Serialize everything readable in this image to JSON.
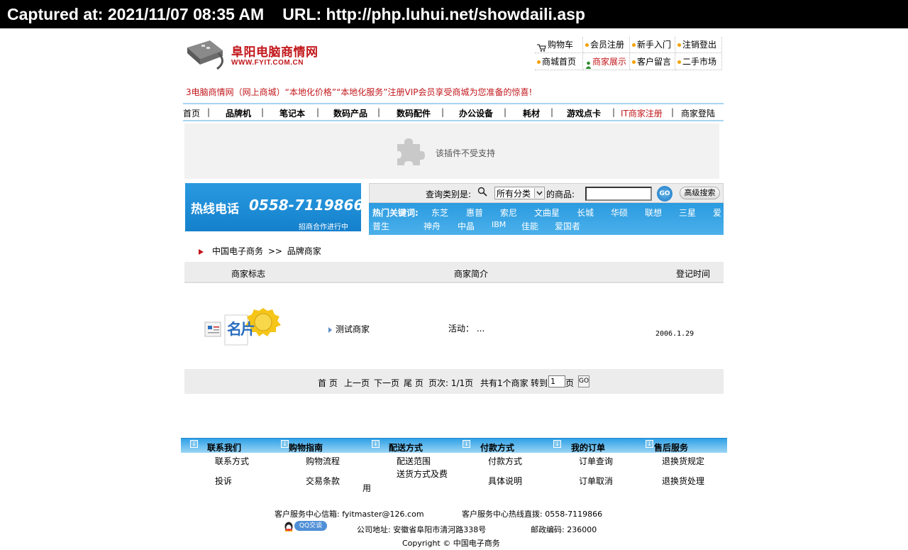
{
  "capture": {
    "captured_at": "Captured at: 2021/11/07 08:35 AM",
    "url": "URL: http://php.luhui.net/showdaili.asp"
  },
  "logo": {
    "name": "阜阳电脑商情网",
    "url": "WWW.FYIT.COM.CN"
  },
  "top_links": {
    "cart": "购物车",
    "register": "会员注册",
    "newbie": "新手入门",
    "logout": "注销登出",
    "home": "商城首页",
    "merchants": "商家展示",
    "message": "客户留言",
    "secondhand": "二手市场"
  },
  "announcement": "3电脑商情网（网上商城）“本地化价格”“本地化服务”注册VIP会员享受商城为您准备的惊喜!",
  "nav": {
    "home": "首页",
    "brand_phone": "品牌机",
    "laptop": "笔记本",
    "digital": "数码产品",
    "accessories": "数码配件",
    "office": "办公设备",
    "consumables": "耗材",
    "game_cards": "游戏点卡",
    "it_register": "IT商家注册",
    "merchant_login": "商家登陆"
  },
  "plugin": {
    "message": "该插件不受支持"
  },
  "hotline": {
    "label": "热线电话",
    "number": "0558-7119866",
    "subtitle": "招商合作进行中"
  },
  "search": {
    "category_label": "查询类别是:",
    "category_value": "所有分类",
    "goods_label": "的商品:",
    "go": "GO",
    "advanced": "高级搜索",
    "hot_label": "热门关键词:",
    "hot_row1": [
      "东芝",
      "惠普",
      "索尼",
      "文曲星",
      "长城",
      "华硕",
      "联想",
      "三星",
      "爱"
    ],
    "hot_row2": [
      "普生",
      "神舟",
      "中晶",
      "IBM",
      "佳能",
      "爱国者"
    ]
  },
  "breadcrumb": {
    "root": "中国电子商务",
    "sep": ">>",
    "current": "品牌商家"
  },
  "table": {
    "col_logo": "商家标志",
    "col_intro": "商家简介",
    "col_time": "登记时间",
    "rows": [
      {
        "logo_text": "名片",
        "name": "测试商家",
        "activity": "活动： ...",
        "date": "2006.1.29"
      }
    ]
  },
  "pager": {
    "first": "首 页",
    "prev": "上一页",
    "next": "下一页",
    "last": "尾 页",
    "info": "页次: 1/1页",
    "total": "共有1个商家",
    "goto": "转到",
    "page_value": "1",
    "page_unit": "页",
    "go": "GO"
  },
  "footer": {
    "headers": [
      "联系我们",
      "购物指南",
      "配送方式",
      "付款方式",
      "我的订单",
      "售后服务"
    ],
    "row1": [
      "联系方式",
      "购物流程",
      "配送范围",
      "付款方式",
      "订单查询",
      "退换货规定"
    ],
    "row2": [
      "投诉",
      "交易条款",
      "送货方式及费",
      "具体说明",
      "订单取消",
      "退换货处理"
    ],
    "row2_wrap": "用",
    "email": "客户服务中心信箱: fyitmaster@126.com",
    "phone": "客户服务中心热线直拨: 0558-7119866",
    "qq": "QQ交谈",
    "address": "公司地址: 安徽省阜阳市清河路338号",
    "postcode": "邮政编码: 236000",
    "copyright": "Copyright © 中国电子商务"
  },
  "colors": {
    "brand_red": "#c2171b",
    "nav_blue": "#2b9be0",
    "panel_gray": "#ececec"
  }
}
